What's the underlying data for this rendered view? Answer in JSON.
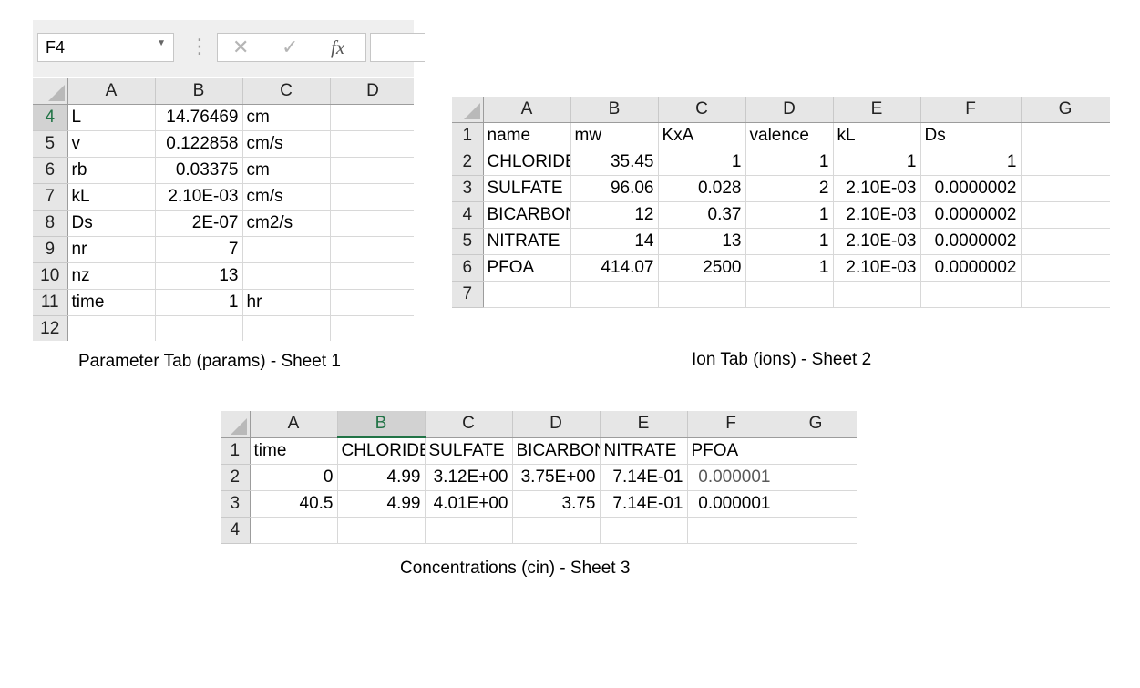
{
  "params_sheet": {
    "name_box": "F4",
    "formula_buttons": {
      "cancel": "✕",
      "enter": "✓",
      "fx": "fx"
    },
    "columns": [
      "A",
      "B",
      "C",
      "D"
    ],
    "rows": [
      {
        "num": "4",
        "cells": [
          "L",
          "14.76469",
          "cm",
          ""
        ]
      },
      {
        "num": "5",
        "cells": [
          "v",
          "0.122858",
          "cm/s",
          ""
        ]
      },
      {
        "num": "6",
        "cells": [
          "rb",
          "0.03375",
          "cm",
          ""
        ]
      },
      {
        "num": "7",
        "cells": [
          "kL",
          "2.10E-03",
          "cm/s",
          ""
        ]
      },
      {
        "num": "8",
        "cells": [
          "Ds",
          "2E-07",
          "cm2/s",
          ""
        ]
      },
      {
        "num": "9",
        "cells": [
          "nr",
          "7",
          "",
          ""
        ]
      },
      {
        "num": "10",
        "cells": [
          "nz",
          "13",
          "",
          ""
        ]
      },
      {
        "num": "11",
        "cells": [
          "time",
          "1",
          "hr",
          ""
        ]
      },
      {
        "num": "12",
        "cells": [
          "",
          "",
          "",
          ""
        ]
      }
    ],
    "caption": "Parameter Tab (params) - Sheet 1"
  },
  "ions_sheet": {
    "columns": [
      "A",
      "B",
      "C",
      "D",
      "E",
      "F",
      "G"
    ],
    "rows": [
      {
        "num": "1",
        "cells": [
          "name",
          "mw",
          "KxA",
          "valence",
          "kL",
          "Ds",
          ""
        ]
      },
      {
        "num": "2",
        "cells": [
          "CHLORIDE",
          "35.45",
          "1",
          "1",
          "1",
          "1",
          ""
        ]
      },
      {
        "num": "3",
        "cells": [
          "SULFATE",
          "96.06",
          "0.028",
          "2",
          "2.10E-03",
          "0.0000002",
          ""
        ]
      },
      {
        "num": "4",
        "cells": [
          "BICARBONATE",
          "12",
          "0.37",
          "1",
          "2.10E-03",
          "0.0000002",
          ""
        ]
      },
      {
        "num": "5",
        "cells": [
          "NITRATE",
          "14",
          "13",
          "1",
          "2.10E-03",
          "0.0000002",
          ""
        ]
      },
      {
        "num": "6",
        "cells": [
          "PFOA",
          "414.07",
          "2500",
          "1",
          "2.10E-03",
          "0.0000002",
          ""
        ]
      },
      {
        "num": "7",
        "cells": [
          "",
          "",
          "",
          "",
          "",
          "",
          ""
        ]
      }
    ],
    "caption": "Ion Tab (ions) - Sheet 2"
  },
  "cin_sheet": {
    "columns": [
      "A",
      "B",
      "C",
      "D",
      "E",
      "F",
      "G"
    ],
    "rows": [
      {
        "num": "1",
        "cells": [
          "time",
          "CHLORIDE",
          "SULFATE",
          "BICARBONATE",
          "NITRATE",
          "PFOA",
          ""
        ]
      },
      {
        "num": "2",
        "cells": [
          "0",
          "4.99",
          "3.12E+00",
          "3.75E+00",
          "7.14E-01",
          "0.000001",
          ""
        ]
      },
      {
        "num": "3",
        "cells": [
          "40.5",
          "4.99",
          "4.01E+00",
          "3.75",
          "7.14E-01",
          "0.000001",
          ""
        ]
      },
      {
        "num": "4",
        "cells": [
          "",
          "",
          "",
          "",
          "",
          "",
          ""
        ]
      }
    ],
    "caption": "Concentrations (cin) - Sheet 3"
  }
}
